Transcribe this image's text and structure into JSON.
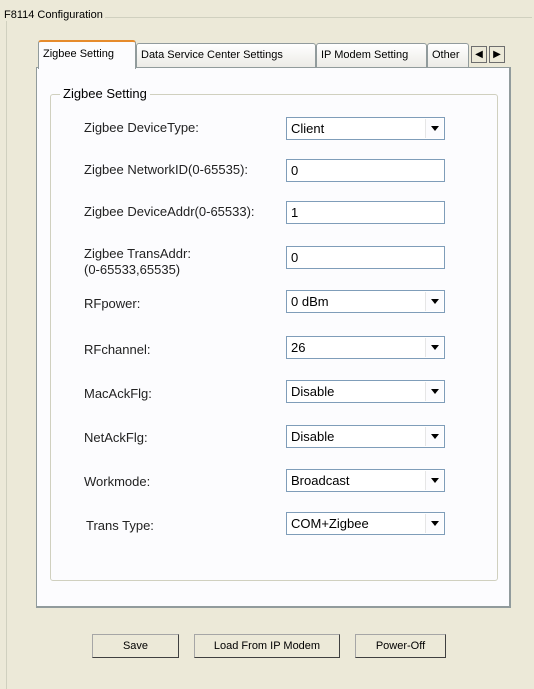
{
  "group_title": "F8114 Configuration",
  "tabs": [
    {
      "label": "Zigbee Setting"
    },
    {
      "label": "Data Service Center Settings"
    },
    {
      "label": "IP Modem Setting"
    },
    {
      "label": "Other"
    }
  ],
  "section_title": "Zigbee Setting",
  "fields": {
    "device_type": {
      "label": "Zigbee DeviceType:",
      "value": "Client"
    },
    "network_id": {
      "label": "Zigbee NetworkID(0-65535):",
      "value": "0"
    },
    "device_addr": {
      "label": "Zigbee DeviceAddr(0-65533):",
      "value": "1"
    },
    "trans_addr": {
      "label_line1": "Zigbee TransAddr:",
      "label_line2": "(0-65533,65535)",
      "value": "0"
    },
    "rfpower": {
      "label": "RFpower:",
      "value": "0 dBm"
    },
    "rfchannel": {
      "label": "RFchannel:",
      "value": "26"
    },
    "macackflg": {
      "label": "MacAckFlg:",
      "value": "Disable"
    },
    "netackflg": {
      "label": "NetAckFlg:",
      "value": "Disable"
    },
    "workmode": {
      "label": "Workmode:",
      "value": "Broadcast"
    },
    "trans_type": {
      "label": "Trans Type:",
      "value": "COM+Zigbee"
    }
  },
  "buttons": {
    "save": "Save",
    "load": "Load From IP Modem",
    "power_off": "Power-Off"
  }
}
